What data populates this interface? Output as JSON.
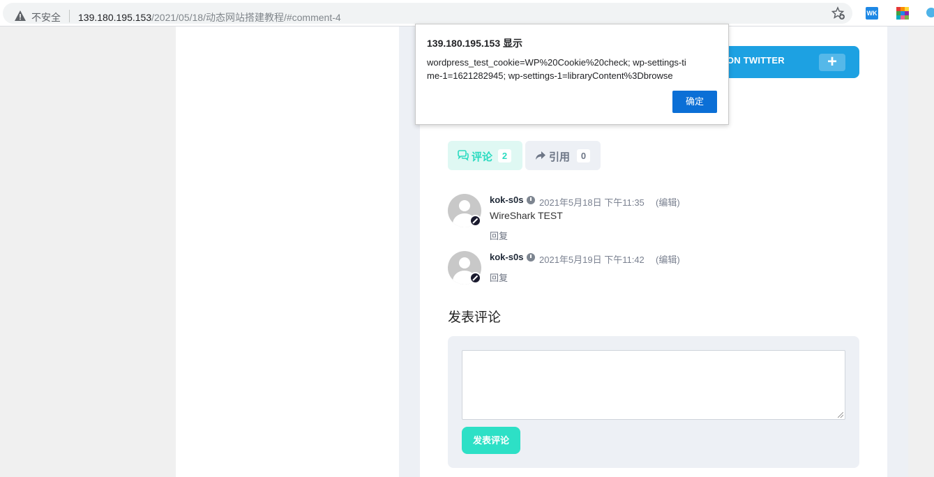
{
  "browser": {
    "security_label": "不安全",
    "url_host": "139.180.195.153",
    "url_path": "/2021/05/18/动态网站搭建教程/#comment-4",
    "extension_1_label": "WK"
  },
  "share": {
    "twitter_label": "ON TWITTER",
    "plus_label": "+"
  },
  "comments_section": {
    "heading": "",
    "tabs": [
      {
        "label": "评论",
        "count": "2",
        "icon": "comments-icon"
      },
      {
        "label": "引用",
        "count": "0",
        "icon": "share-icon"
      }
    ],
    "items": [
      {
        "author": "kok-s0s",
        "time": "2021年5月18日 下午11:35",
        "edit": "(编辑)",
        "text": "WireShark TEST",
        "reply": "回复"
      },
      {
        "author": "kok-s0s",
        "time": "2021年5月19日 下午11:42",
        "edit": "(编辑)",
        "text": "",
        "reply": "回复"
      }
    ]
  },
  "comment_form": {
    "heading": "发表评论",
    "textarea_value": "",
    "submit_label": "发表评论"
  },
  "alert": {
    "title": "139.180.195.153 显示",
    "message": "wordpress_test_cookie=WP%20Cookie%20check; wp-settings-time-1=1621282945; wp-settings-1=libraryContent%3Dbrowse",
    "ok_label": "确定"
  },
  "colors": {
    "accent": "#2de0c6",
    "twitter": "#1da1e2",
    "dialog_button": "#0b6fd6"
  }
}
